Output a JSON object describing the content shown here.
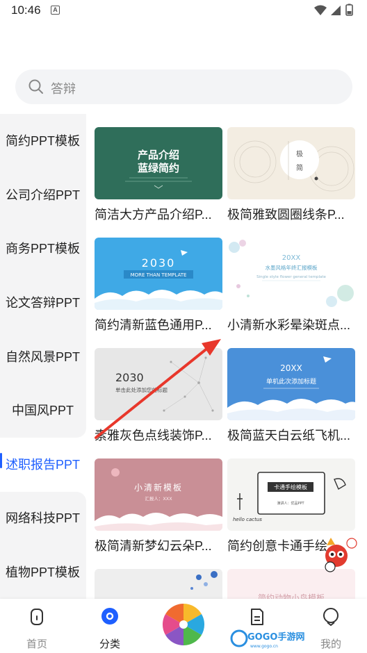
{
  "status": {
    "time": "10:46",
    "badge": "A"
  },
  "search": {
    "placeholder": "答辩"
  },
  "categories": [
    {
      "label": "简约PPT模板"
    },
    {
      "label": "公司介绍PPT"
    },
    {
      "label": "商务PPT模板"
    },
    {
      "label": "论文答辩PPT"
    },
    {
      "label": "自然风景PPT"
    },
    {
      "label": "中国风PPT"
    },
    {
      "label": "述职报告PPT",
      "active": true
    },
    {
      "label": "网络科技PPT"
    },
    {
      "label": "植物PPT模板"
    }
  ],
  "cards": [
    {
      "title": "简洁大方产品介绍P...",
      "thumb": {
        "line1": "产品介绍",
        "line2": "蓝绿简约",
        "bg": "#2f6e5a"
      }
    },
    {
      "title": "极简雅致圆圈线条P...",
      "thumb": {
        "line1": "极",
        "line2": "简",
        "bg": "#f3ede2"
      }
    },
    {
      "title": "简约清新蓝色通用P...",
      "thumb": {
        "line1": "2030",
        "line2": "MORE THAN TEMPLATE",
        "bg": "#3fa9e6"
      }
    },
    {
      "title": "小清新水彩晕染斑点...",
      "thumb": {
        "line1": "20XX",
        "line2": "水墨风格年终汇报模板",
        "line3": "Single style flower general template",
        "bg": "#ffffff"
      }
    },
    {
      "title": "素雅灰色点线装饰P...",
      "thumb": {
        "line1": "2030",
        "line2": "单击此处添加您的标题",
        "bg": "#e7e7e7"
      }
    },
    {
      "title": "极简蓝天白云纸飞机...",
      "thumb": {
        "line1": "20XX",
        "line2": "单机此次添加标题",
        "bg": "#4a90d9"
      }
    },
    {
      "title": "极简清新梦幻云朵P...",
      "thumb": {
        "line1": "小清新模板",
        "line2": "汇报人：XXX",
        "bg": "#c98f96"
      }
    },
    {
      "title": "简约创意卡通手绘...",
      "thumb": {
        "line1": "卡通手绘模板",
        "line2": "hello cactus",
        "line3": "演讲人：优品PPT",
        "bg": "#f4f4f2"
      }
    },
    {
      "title": "",
      "thumb": {
        "bg": "#eeeeee"
      }
    },
    {
      "title": "",
      "thumb": {
        "line1": "简约动物小鸟模板",
        "bg": "#fbeef0"
      }
    }
  ],
  "nav": {
    "home": "首页",
    "category": "分类",
    "docs": "",
    "mine": "我的"
  },
  "watermark": {
    "text": "GOGO手游网",
    "sub": "www.gogo.cn"
  },
  "colors": {
    "accent": "#1e5fff",
    "arrow": "#e8372b"
  }
}
